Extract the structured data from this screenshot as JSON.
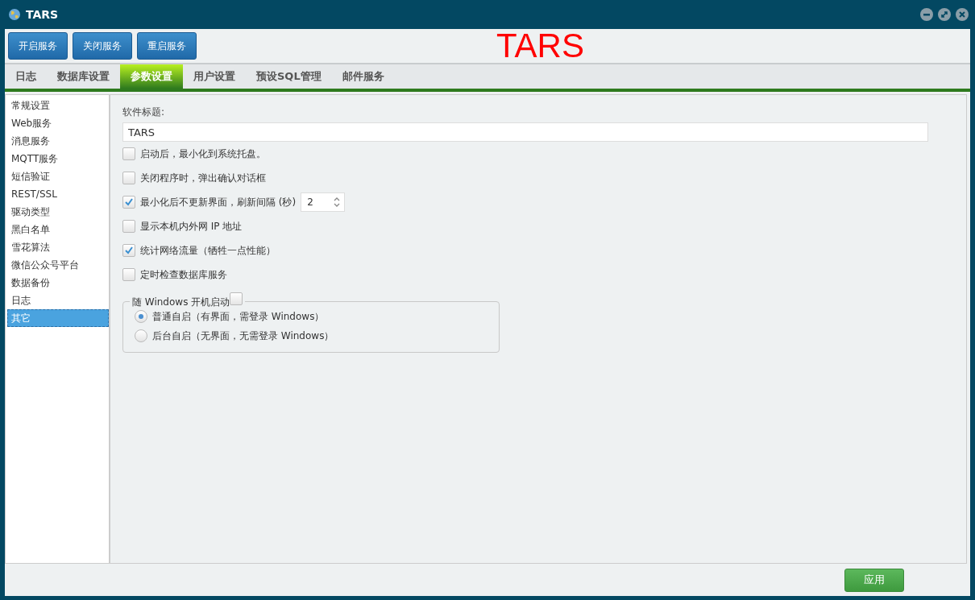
{
  "window": {
    "title": "TARS"
  },
  "toolbar": {
    "buttons": [
      "开启服务",
      "关闭服务",
      "重启服务"
    ],
    "banner": "TARS"
  },
  "tabs": [
    {
      "label": "日志",
      "selected": false
    },
    {
      "label": "数据库设置",
      "selected": false
    },
    {
      "label": "参数设置",
      "selected": true
    },
    {
      "label": "用户设置",
      "selected": false
    },
    {
      "label": "预设SQL管理",
      "selected": false
    },
    {
      "label": "邮件服务",
      "selected": false
    }
  ],
  "sidebar": {
    "items": [
      {
        "label": "常规设置",
        "selected": false
      },
      {
        "label": "Web服务",
        "selected": false
      },
      {
        "label": "消息服务",
        "selected": false
      },
      {
        "label": "MQTT服务",
        "selected": false
      },
      {
        "label": "短信验证",
        "selected": false
      },
      {
        "label": "REST/SSL",
        "selected": false
      },
      {
        "label": "驱动类型",
        "selected": false
      },
      {
        "label": "黑白名单",
        "selected": false
      },
      {
        "label": "雪花算法",
        "selected": false
      },
      {
        "label": "微信公众号平台",
        "selected": false
      },
      {
        "label": "数据备份",
        "selected": false
      },
      {
        "label": "日志",
        "selected": false
      },
      {
        "label": "其它",
        "selected": true
      }
    ]
  },
  "title_field": {
    "label": "软件标题:",
    "value": "TARS"
  },
  "options": [
    {
      "kind": "checkbox",
      "label": "启动后，最小化到系统托盘。",
      "checked": false
    },
    {
      "kind": "checkbox",
      "label": "关闭程序时，弹出确认对话框",
      "checked": false
    },
    {
      "kind": "spinner",
      "label": "最小化后不更新界面，刷新间隔 (秒)",
      "checked": true,
      "value": "2"
    },
    {
      "kind": "checkbox",
      "label": "显示本机内外网 IP 地址",
      "checked": false
    },
    {
      "kind": "checkbox",
      "label": "统计网络流量（牺牲一点性能）",
      "checked": true
    },
    {
      "kind": "checkbox",
      "label": "定时检查数据库服务",
      "checked": false
    }
  ],
  "autostart": {
    "label": "随 Windows 开机启动",
    "checked": false,
    "options": [
      {
        "label": "普通自启（有界面，需登录 Windows）",
        "selected": true
      },
      {
        "label": "后台自启（无界面，无需登录 Windows）",
        "selected": false
      }
    ]
  },
  "apply_button": "应用"
}
